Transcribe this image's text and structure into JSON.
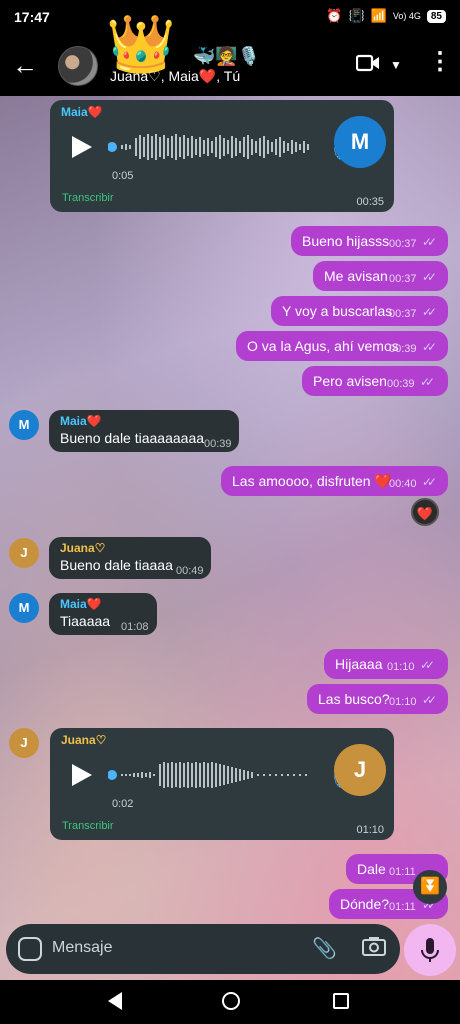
{
  "status_bar": {
    "time": "17:47",
    "battery": "85",
    "network": "Vo) 4G"
  },
  "header": {
    "title": "Juana♡, Maia❤️, Tú",
    "crown": "👑",
    "emojis": "🐳🧑‍🏫🎙️"
  },
  "colors": {
    "out_bubble": "#b23fd0",
    "in_bubble": "#2a3236",
    "maia_avatar": "#1a7fd1",
    "juana_avatar": "#c8913e"
  },
  "messages": [
    {
      "type": "voice",
      "sender": "Maia❤️",
      "duration": "0:05",
      "time": "00:35",
      "transcribe": "Transcribir",
      "avatar": "M"
    },
    {
      "type": "out",
      "text": "Bueno hijasss",
      "time": "00:37"
    },
    {
      "type": "out",
      "text": "Me avisan",
      "time": "00:37"
    },
    {
      "type": "out",
      "text": "Y voy a buscarlas",
      "time": "00:37"
    },
    {
      "type": "out",
      "text": "O va la Agus, ahí vemos",
      "time": "00:39"
    },
    {
      "type": "out",
      "text": "Pero avisen",
      "time": "00:39"
    },
    {
      "type": "in",
      "sender": "Maia❤️",
      "text": "Bueno dale tiaaaaaaaa",
      "time": "00:39",
      "avatar": "M"
    },
    {
      "type": "out",
      "text": "Las amoooo, disfruten ❤️",
      "time": "00:40",
      "reaction": "❤️"
    },
    {
      "type": "in",
      "sender": "Juana♡",
      "text": "Bueno dale tiaaaa",
      "time": "00:49",
      "avatar": "J"
    },
    {
      "type": "in",
      "sender": "Maia❤️",
      "text": "Tiaaaaa",
      "time": "01:08",
      "avatar": "M"
    },
    {
      "type": "out",
      "text": "Hijaaaa",
      "time": "01:10"
    },
    {
      "type": "out",
      "text": "Las busco?",
      "time": "01:10"
    },
    {
      "type": "voice",
      "sender": "Juana♡",
      "duration": "0:02",
      "time": "01:10",
      "transcribe": "Transcribir",
      "avatar": "J"
    },
    {
      "type": "out",
      "text": "Dale",
      "time": "01:11"
    },
    {
      "type": "out",
      "text": "Dónde?",
      "time": "01:11"
    }
  ],
  "input": {
    "placeholder": "Mensaje"
  },
  "ticks": "✓✓"
}
